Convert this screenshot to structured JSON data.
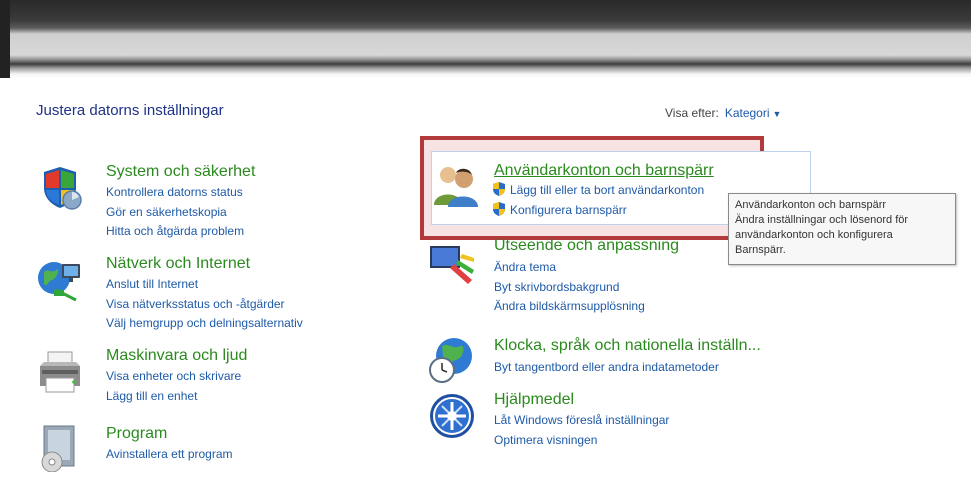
{
  "page": {
    "title": "Justera datorns inställningar",
    "view_by_label": "Visa efter:",
    "view_by_value": "Kategori"
  },
  "categories": {
    "system": {
      "title": "System och säkerhet",
      "icon": "shield-icon",
      "links": [
        "Kontrollera datorns status",
        "Gör en säkerhetskopia",
        "Hitta och åtgärda problem"
      ]
    },
    "network": {
      "title": "Nätverk och Internet",
      "icon": "network-globe-icon",
      "links": [
        "Anslut till Internet",
        "Visa nätverksstatus och -åtgärder",
        "Välj hemgrupp och delningsalternativ"
      ]
    },
    "hardware": {
      "title": "Maskinvara och ljud",
      "icon": "printer-icon",
      "links": [
        "Visa enheter och skrivare",
        "Lägg till en enhet"
      ]
    },
    "programs": {
      "title": "Program",
      "icon": "programs-icon",
      "links": [
        "Avinstallera ett program"
      ]
    },
    "users": {
      "title": "Användarkonton och barnspärr",
      "icon": "users-icon",
      "links": [
        "Lägg till eller ta bort användarkonton",
        "Konfigurera barnspärr"
      ]
    },
    "appearance": {
      "title": "Utseende och anpassning",
      "icon": "appearance-icon",
      "links": [
        "Ändra tema",
        "Byt skrivbordsbakgrund",
        "Ändra bildskärmsupplösning"
      ]
    },
    "clock": {
      "title": "Klocka, språk och nationella inställn...",
      "icon": "clock-globe-icon",
      "links": [
        "Byt tangentbord eller andra indatametoder"
      ]
    },
    "ease": {
      "title": "Hjälpmedel",
      "icon": "ease-of-access-icon",
      "links": [
        "Låt Windows föreslå inställningar",
        "Optimera visningen"
      ]
    }
  },
  "tooltip": {
    "lines": [
      "Användarkonton och barnspärr",
      "Ändra inställningar och lösenord för",
      "användarkonton och konfigurera",
      "Barnspärr."
    ]
  },
  "colors": {
    "category_title": "#2b8a1e",
    "link": "#1e5aa8",
    "page_title": "#1e3287",
    "highlight_border": "#b33a3a"
  }
}
